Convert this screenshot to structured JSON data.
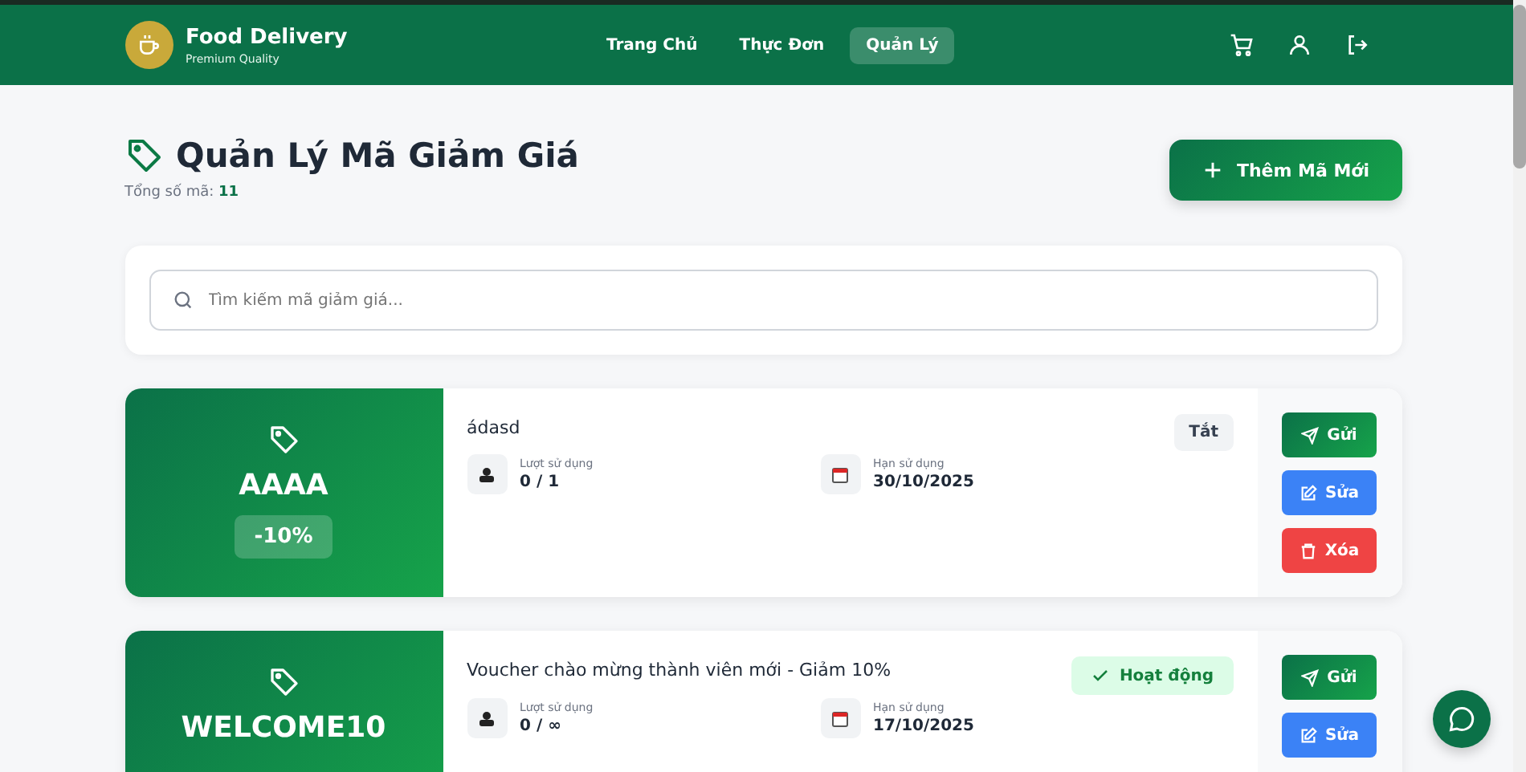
{
  "header": {
    "brand": "Food Delivery",
    "tagline": "Premium Quality",
    "nav": [
      {
        "label": "Trang Chủ",
        "selected": false
      },
      {
        "label": "Thực Đơn",
        "selected": false
      },
      {
        "label": "Quản Lý",
        "selected": true
      }
    ]
  },
  "page": {
    "title": "Quản Lý Mã Giảm Giá",
    "total_label": "Tổng số mã:",
    "total": "11",
    "add_button": "Thêm Mã Mới"
  },
  "search": {
    "placeholder": "Tìm kiếm mã giảm giá..."
  },
  "coupons": [
    {
      "code": "AAAA",
      "discount": "-10%",
      "description": "ádasd",
      "active": false,
      "status": "Tắt",
      "usage_label": "Lượt sử dụng",
      "usage": "0 / 1",
      "expiry_label": "Hạn sử dụng",
      "expiry": "30/10/2025",
      "actions": [
        {
          "kind": "send",
          "label": "Gửi"
        },
        {
          "kind": "edit",
          "label": "Sửa"
        },
        {
          "kind": "delete",
          "label": "Xóa"
        }
      ]
    },
    {
      "code": "WELCOME10",
      "description": "Voucher chào mừng thành viên mới - Giảm 10%",
      "active": true,
      "status": "Hoạt động",
      "usage_label": "Lượt sử dụng",
      "usage": "0 / ∞",
      "expiry_label": "Hạn sử dụng",
      "expiry": "17/10/2025",
      "actions": [
        {
          "kind": "send",
          "label": "Gửi"
        },
        {
          "kind": "edit",
          "label": "Sửa"
        }
      ]
    }
  ]
}
